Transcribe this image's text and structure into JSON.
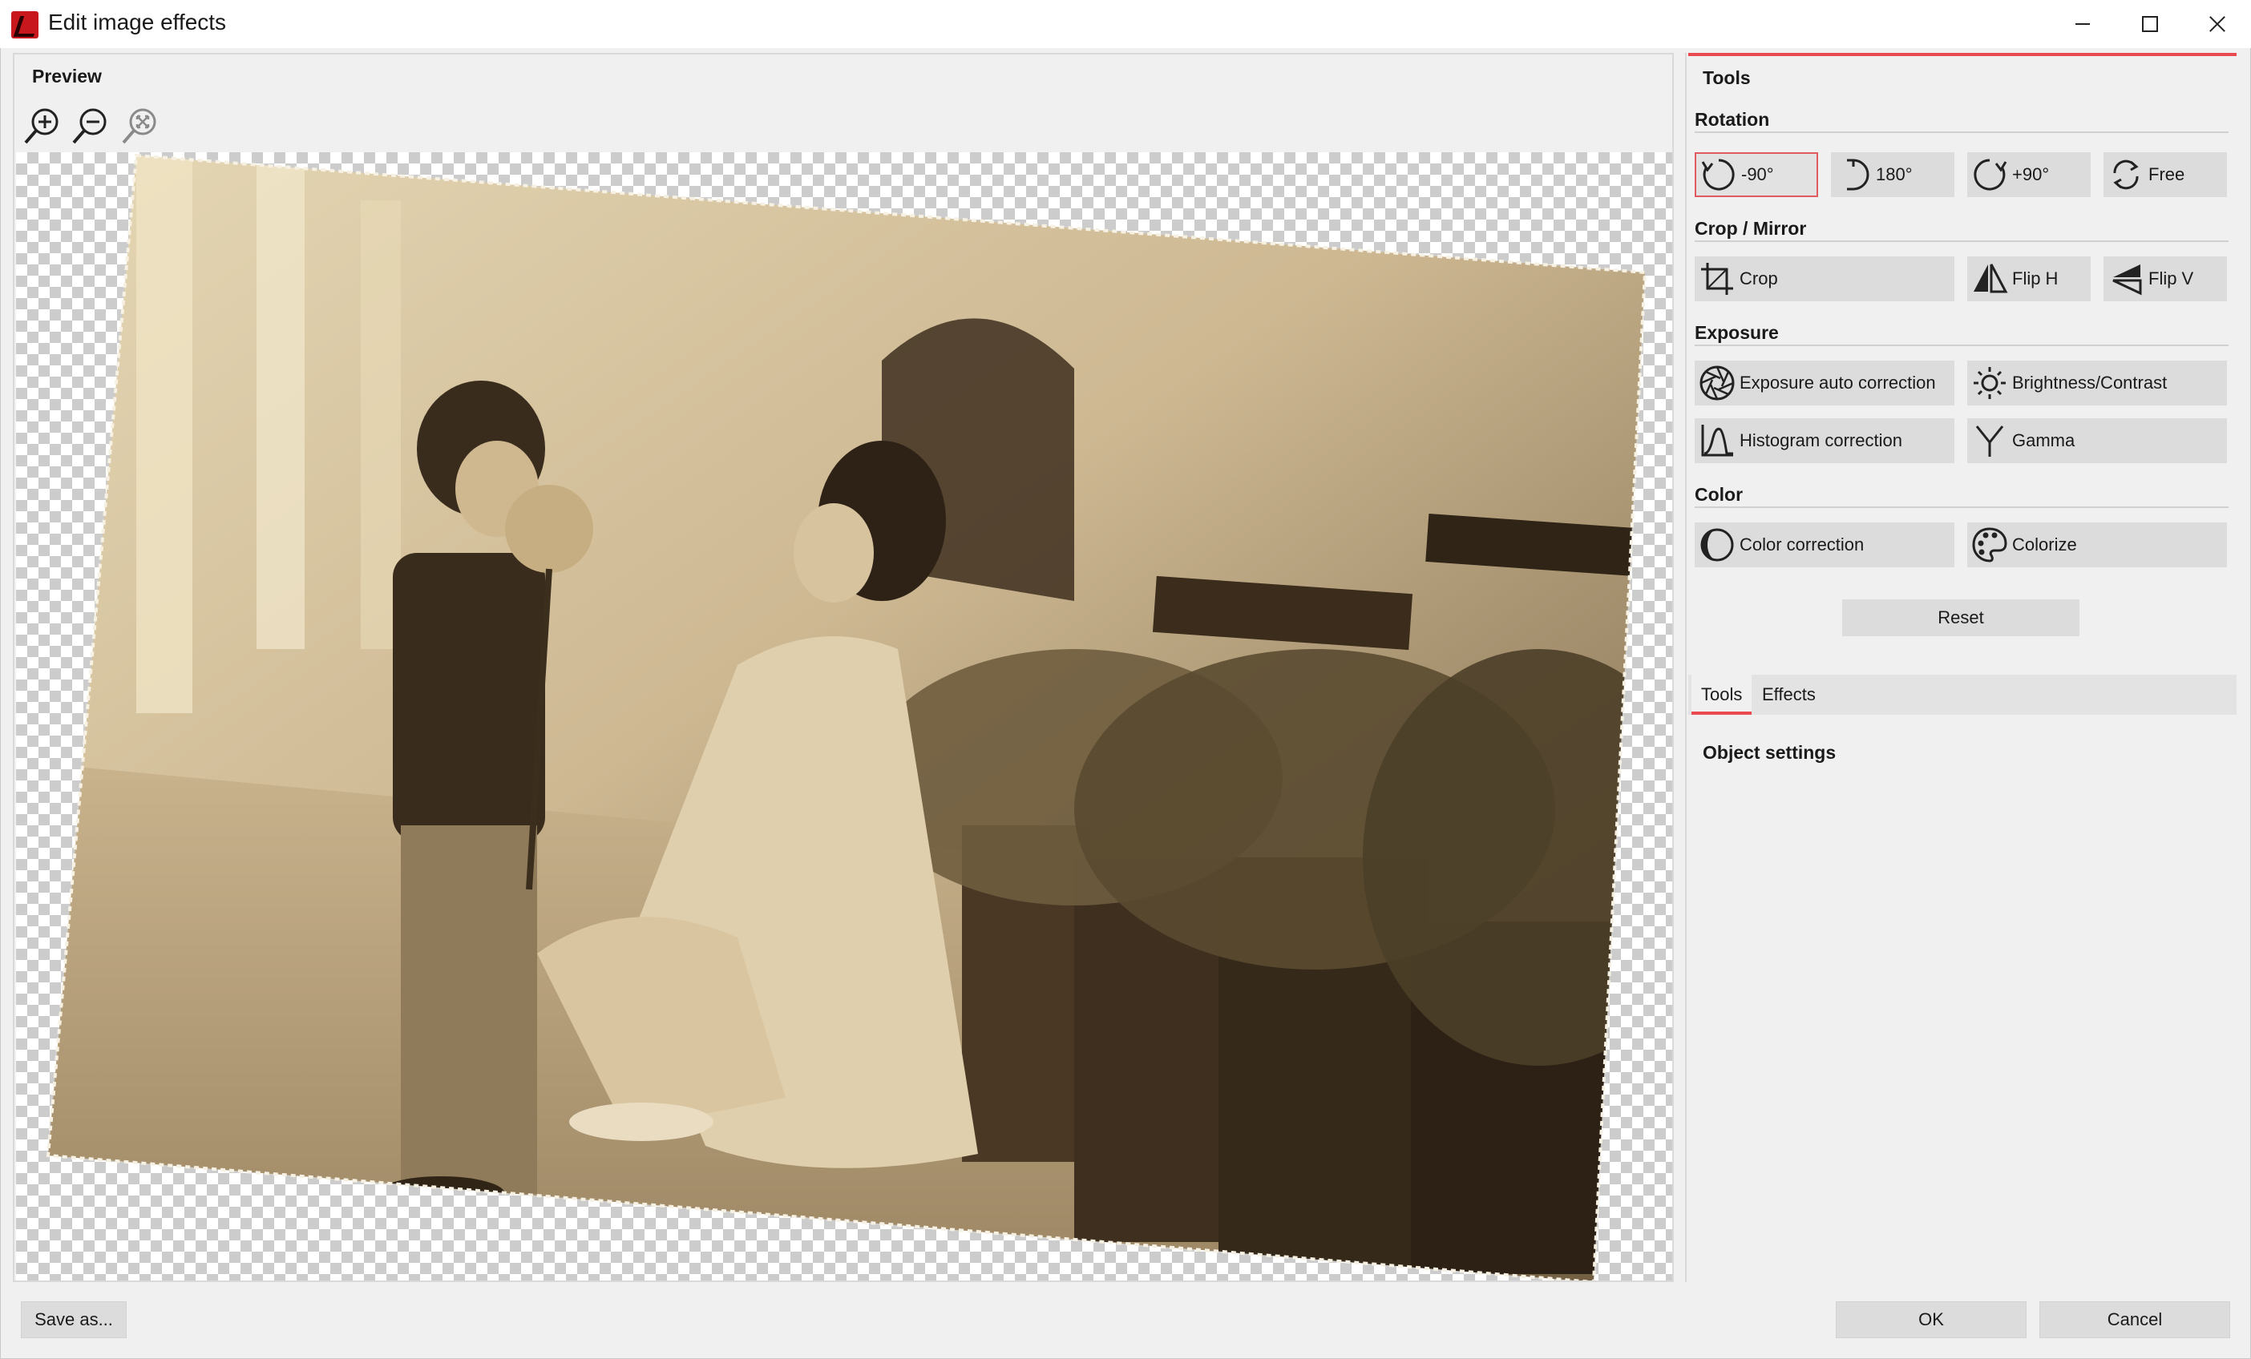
{
  "window": {
    "title": "Edit image effects",
    "icons": [
      "app-icon",
      "minimize-icon",
      "maximize-icon",
      "close-icon"
    ]
  },
  "preview": {
    "title": "Preview",
    "zoom_icons": [
      "zoom-in-icon",
      "zoom-out-icon",
      "zoom-fit-icon"
    ]
  },
  "tools": {
    "header": "Tools",
    "rotation": {
      "label": "Rotation",
      "buttons": [
        {
          "label": "-90°",
          "icon": "rotate-left-icon",
          "selected": true
        },
        {
          "label": "180°",
          "icon": "rotate-180-icon"
        },
        {
          "label": "+90°",
          "icon": "rotate-right-icon"
        },
        {
          "label": "Free",
          "icon": "free-rotate-icon"
        }
      ]
    },
    "crop_mirror": {
      "label": "Crop / Mirror",
      "buttons": [
        {
          "label": "Crop",
          "icon": "crop-icon"
        },
        {
          "label": "Flip H",
          "icon": "flip-horizontal-icon"
        },
        {
          "label": "Flip V",
          "icon": "flip-vertical-icon"
        }
      ]
    },
    "exposure": {
      "label": "Exposure",
      "buttons": [
        {
          "label": "Exposure auto correction",
          "icon": "aperture-icon"
        },
        {
          "label": "Brightness/Contrast",
          "icon": "sun-icon"
        },
        {
          "label": "Histogram correction",
          "icon": "histogram-icon"
        },
        {
          "label": "Gamma",
          "icon": "gamma-icon"
        }
      ]
    },
    "color": {
      "label": "Color",
      "buttons": [
        {
          "label": "Color correction",
          "icon": "half-circle-icon"
        },
        {
          "label": "Colorize",
          "icon": "palette-icon"
        }
      ]
    },
    "reset_label": "Reset"
  },
  "tabs": [
    {
      "label": "Tools",
      "active": true
    },
    {
      "label": "Effects",
      "active": false
    }
  ],
  "object_settings": "Object settings",
  "footer": {
    "save_as": "Save as...",
    "ok": "OK",
    "cancel": "Cancel"
  },
  "colors": {
    "accent": "#e84a4f",
    "sepia_light": "#d8c8a4",
    "sepia_dark": "#3e2f1f"
  }
}
